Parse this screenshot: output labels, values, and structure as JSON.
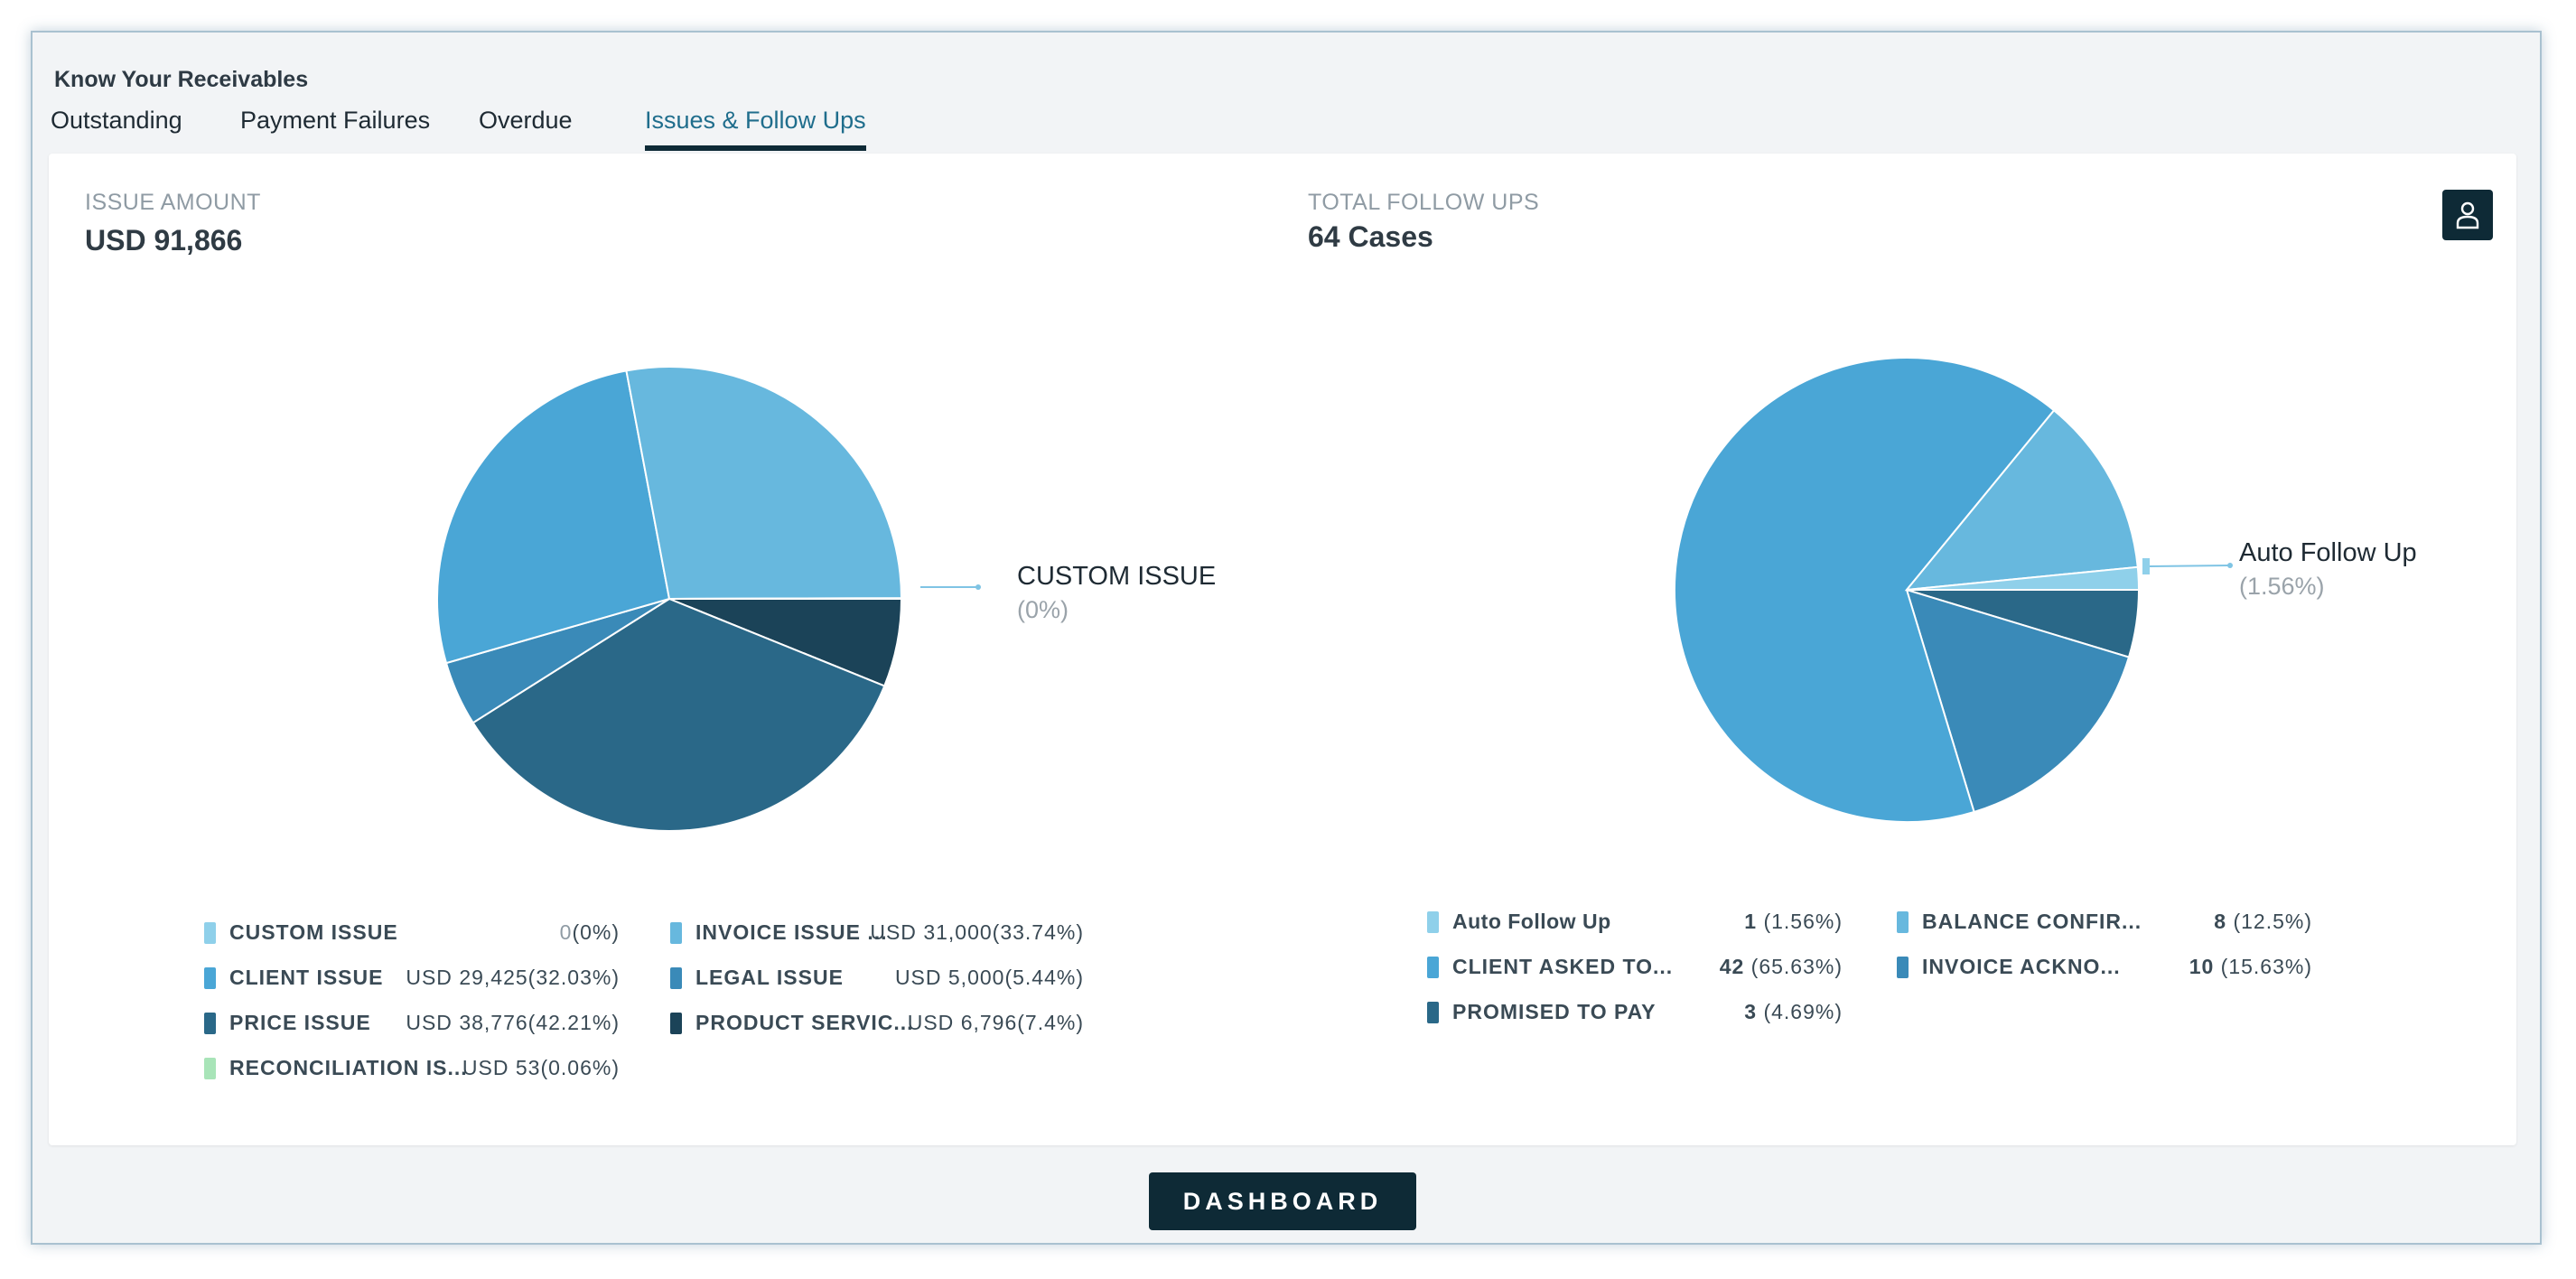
{
  "app": {
    "title": "Know Your Receivables"
  },
  "tabs": [
    {
      "label": "Outstanding"
    },
    {
      "label": "Payment Failures"
    },
    {
      "label": "Overdue"
    },
    {
      "label": "Issues & Follow Ups"
    }
  ],
  "issue_panel": {
    "label": "ISSUE AMOUNT",
    "value": "USD 91,866",
    "callout": {
      "name": "CUSTOM ISSUE",
      "pct": "(0%)"
    },
    "legend": [
      {
        "name": "CUSTOM ISSUE",
        "currency": "",
        "amount": "0",
        "pct": "(0%)"
      },
      {
        "name": "INVOICE ISSUE ...",
        "currency": "USD",
        "amount": "31,000",
        "pct": "(33.74%)"
      },
      {
        "name": "CLIENT ISSUE",
        "currency": "USD",
        "amount": "29,425",
        "pct": "(32.03%)"
      },
      {
        "name": "LEGAL ISSUE",
        "currency": "USD",
        "amount": "5,000",
        "pct": "(5.44%)"
      },
      {
        "name": "PRICE ISSUE",
        "currency": "USD",
        "amount": "38,776",
        "pct": "(42.21%)"
      },
      {
        "name": "PRODUCT SERVIC...",
        "currency": "USD",
        "amount": "6,796",
        "pct": "(7.4%)"
      },
      {
        "name": "RECONCILIATION IS...",
        "currency": "USD",
        "amount": "53",
        "pct": "(0.06%)"
      }
    ]
  },
  "followup_panel": {
    "label": "TOTAL FOLLOW UPS",
    "value": "64 Cases",
    "callout": {
      "name": "Auto Follow Up",
      "pct": "(1.56%)"
    },
    "legend": [
      {
        "name": "Auto Follow Up",
        "count": "1",
        "pct": "(1.56%)"
      },
      {
        "name": "BALANCE CONFIR...",
        "count": "8",
        "pct": "(12.5%)"
      },
      {
        "name": "CLIENT ASKED TO...",
        "count": "42",
        "pct": "(65.63%)"
      },
      {
        "name": "INVOICE ACKNO...",
        "count": "10",
        "pct": "(15.63%)"
      },
      {
        "name": "PROMISED TO PAY",
        "count": "3",
        "pct": "(4.69%)"
      }
    ]
  },
  "footer": {
    "dashboard_label": "DASHBOARD"
  },
  "chart_data": [
    {
      "type": "pie",
      "categories": [
        "CUSTOM ISSUE",
        "INVOICE ISSUE ...",
        "CLIENT ISSUE",
        "LEGAL ISSUE",
        "PRICE ISSUE",
        "PRODUCT SERVIC...",
        "RECONCILIATION IS..."
      ],
      "values": [
        0,
        31000,
        29425,
        5000,
        38776,
        6796,
        53
      ],
      "colors": [
        "#8fd0ea",
        "#67b8de",
        "#4aa6d6",
        "#3a8ab8",
        "#2a6888",
        "#1b4358",
        "#a8e4b8"
      ]
    },
    {
      "type": "pie",
      "categories": [
        "Auto Follow Up",
        "BALANCE CONFIR...",
        "CLIENT ASKED TO...",
        "INVOICE ACKNO...",
        "PROMISED TO PAY"
      ],
      "values": [
        1,
        8,
        42,
        10,
        3
      ],
      "colors": [
        "#8fd0ea",
        "#67b8de",
        "#4aa6d6",
        "#3a8ab8",
        "#2a6888"
      ]
    }
  ]
}
